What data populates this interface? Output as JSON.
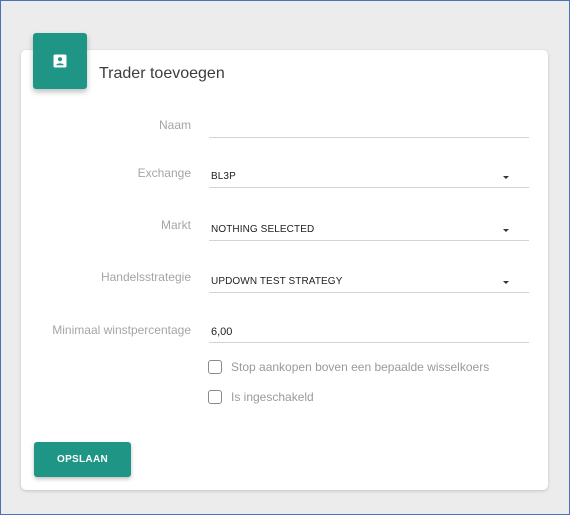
{
  "card": {
    "title": "Trader toevoegen",
    "icon": "contact-card-icon",
    "accent_color": "#1f9585"
  },
  "form": {
    "name": {
      "label": "Naam",
      "value": "",
      "placeholder": ""
    },
    "exchange": {
      "label": "Exchange",
      "selected": "BL3P"
    },
    "market": {
      "label": "Markt",
      "selected": "NOTHING SELECTED"
    },
    "strategy": {
      "label": "Handelsstrategie",
      "selected": "UPDOWN TEST STRATEGY"
    },
    "min_profit": {
      "label": "Minimaal winstpercentage",
      "value": "6,00"
    },
    "stop_buying": {
      "label": "Stop aankopen boven een bepaalde wisselkoers",
      "checked": false
    },
    "enabled": {
      "label": "Is ingeschakeld",
      "checked": false
    }
  },
  "actions": {
    "save_label": "OPSLAAN"
  }
}
